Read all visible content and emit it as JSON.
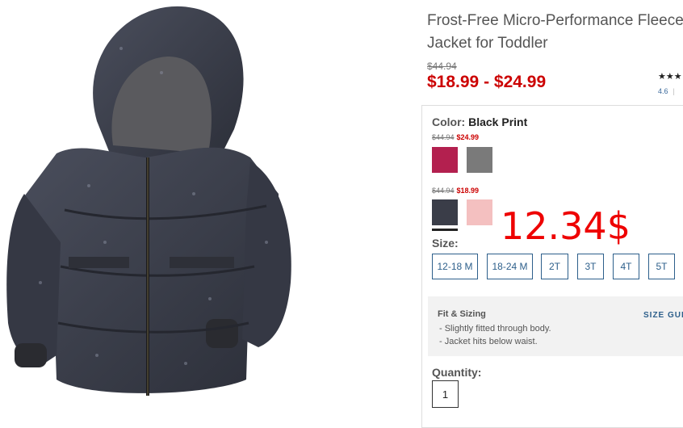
{
  "product": {
    "title_line1": "Frost-Free Micro-Performance Fleece",
    "title_line2": "Jacket for Toddler",
    "original_price": "$44.94",
    "sale_price_range": "$18.99 - $24.99",
    "stars": "★★★",
    "rating_value": "4.6",
    "rating_sep": "|"
  },
  "color": {
    "label": "Color:",
    "selected": "Black Print",
    "group1": {
      "strike_price": "$44.94",
      "sale_price": "$24.99"
    },
    "group2": {
      "strike_price": "$44.94",
      "sale_price": "$18.99"
    }
  },
  "swatches": [
    {
      "name": "magenta",
      "color": "#b3204f"
    },
    {
      "name": "grey-print",
      "color": "#7a7a7a"
    },
    {
      "name": "black-print",
      "color": "#3a3d48",
      "selected": true
    },
    {
      "name": "light-pink",
      "color": "#f4c0c0"
    }
  ],
  "overlay_price": "12.34$",
  "size": {
    "label": "Size:",
    "options": [
      "12-18 M",
      "18-24 M",
      "2T",
      "3T",
      "4T",
      "5T"
    ]
  },
  "fit": {
    "title": "Fit & Sizing",
    "size_guide": "SIZE GUI",
    "lines": [
      "- Slightly fitted through body.",
      "- Jacket hits below waist."
    ]
  },
  "quantity": {
    "label": "Quantity:",
    "value": "1"
  }
}
